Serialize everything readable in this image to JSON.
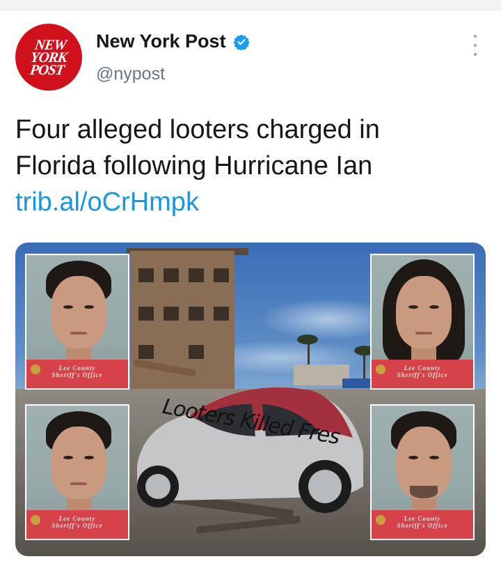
{
  "tweet": {
    "logo_text": "NEW\nYORK\nPOST",
    "display_name": "New York Post",
    "handle": "@nypost",
    "text_line1": "Four alleged looters charged in",
    "text_line2": "Florida following Hurricane Ian",
    "link": "trib.al/oCrHmpk"
  },
  "media": {
    "car_graffiti": "Looters Killed Fres",
    "mugshots": [
      {
        "caption_line1": "Lee County",
        "caption_line2": "Sheriff's Office"
      },
      {
        "caption_line1": "Lee County",
        "caption_line2": "Sheriff's Office"
      },
      {
        "caption_line1": "Lee County",
        "caption_line2": "Sheriff's Office"
      },
      {
        "caption_line1": "Lee County",
        "caption_line2": "Sheriff's Office"
      }
    ]
  },
  "colors": {
    "brand_red": "#d0111b",
    "verified_blue": "#1d9bf0",
    "link_blue": "#1b95e0"
  },
  "icons": {
    "verified": "verified-badge-icon",
    "more": "more-vertical-icon"
  }
}
